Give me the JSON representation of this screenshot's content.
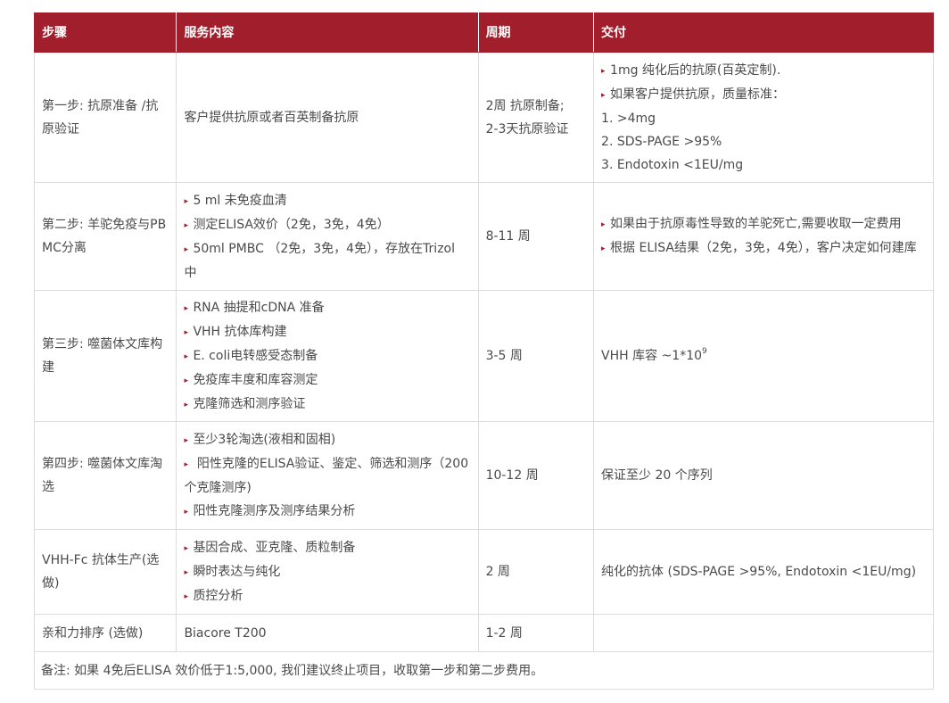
{
  "header": [
    "步骤",
    "服务内容",
    "周期",
    "交付"
  ],
  "rows": [
    {
      "step": "第一步: 抗原准备 /抗原验证",
      "service": [
        {
          "bullet": false,
          "text": "客户提供抗原或者百英制备抗原"
        }
      ],
      "period": [
        "2周 抗原制备;",
        "2-3天抗原验证"
      ],
      "delivery": [
        {
          "bullet": true,
          "text": "1mg 纯化后的抗原(百英定制)."
        },
        {
          "bullet": true,
          "text": "如果客户提供抗原，质量标准："
        },
        {
          "bullet": false,
          "text": "1. >4mg"
        },
        {
          "bullet": false,
          "text": "2. SDS-PAGE >95%"
        },
        {
          "bullet": false,
          "text": "3. Endotoxin <1EU/mg"
        }
      ]
    },
    {
      "step": "第二步: 羊驼免疫与PBMC分离",
      "service": [
        {
          "bullet": true,
          "text": "5 ml 未免疫血清"
        },
        {
          "bullet": true,
          "text": "测定ELISA效价（2免，3免，4免）"
        },
        {
          "bullet": true,
          "text": "50ml PMBC （2免，3免，4免），存放在Trizol 中"
        }
      ],
      "period": [
        "8-11 周"
      ],
      "delivery": [
        {
          "bullet": true,
          "text": "如果由于抗原毒性导致的羊驼死亡,需要收取一定费用"
        },
        {
          "bullet": true,
          "text": "根据 ELISA结果（2免，3免，4免），客户决定如何建库"
        }
      ]
    },
    {
      "step": "第三步: 噬菌体文库构建",
      "service": [
        {
          "bullet": true,
          "text": "RNA 抽提和cDNA 准备"
        },
        {
          "bullet": true,
          "text": "VHH 抗体库构建"
        },
        {
          "bullet": true,
          "text": "E. coli电转感受态制备"
        },
        {
          "bullet": true,
          "text": "免疫库丰度和库容测定"
        },
        {
          "bullet": true,
          "text": "克隆筛选和测序验证"
        }
      ],
      "period": [
        "3-5 周"
      ],
      "delivery_main": "VHH 库容 ~1*10",
      "delivery_sup": "9"
    },
    {
      "step": "第四步: 噬菌体文库淘选",
      "service": [
        {
          "bullet": true,
          "text": "至少3轮淘选(液相和固相)"
        },
        {
          "bullet": true,
          "text": " 阳性克隆的ELISA验证、鉴定、筛选和测序（200个克隆测序)"
        },
        {
          "bullet": true,
          "text": "阳性克隆测序及测序结果分析"
        }
      ],
      "period": [
        "10-12 周"
      ],
      "delivery": [
        {
          "bullet": false,
          "text": "保证至少 20 个序列"
        }
      ]
    },
    {
      "step": "VHH-Fc 抗体生产(选做)",
      "service": [
        {
          "bullet": true,
          "text": "基因合成、亚克隆、质粒制备"
        },
        {
          "bullet": true,
          "text": "瞬时表达与纯化"
        },
        {
          "bullet": true,
          "text": "质控分析"
        }
      ],
      "period": [
        "2 周"
      ],
      "delivery": [
        {
          "bullet": false,
          "text": "纯化的抗体 (SDS-PAGE >95%, Endotoxin <1EU/mg)"
        }
      ]
    },
    {
      "step": "亲和力排序 (选做)",
      "service": [
        {
          "bullet": false,
          "text": "Biacore T200"
        }
      ],
      "period": [
        "1-2 周"
      ],
      "delivery": []
    }
  ],
  "note": "备注: 如果 4免后ELISA 效价低于1:5,000, 我们建议终止项目，收取第一步和第二步费用。",
  "colors": {
    "header_bg": "#a11f2c",
    "bullet": "#a11f2c",
    "border": "#dcdcdc"
  },
  "icons": {
    "bullet": "triangle-right-icon"
  }
}
